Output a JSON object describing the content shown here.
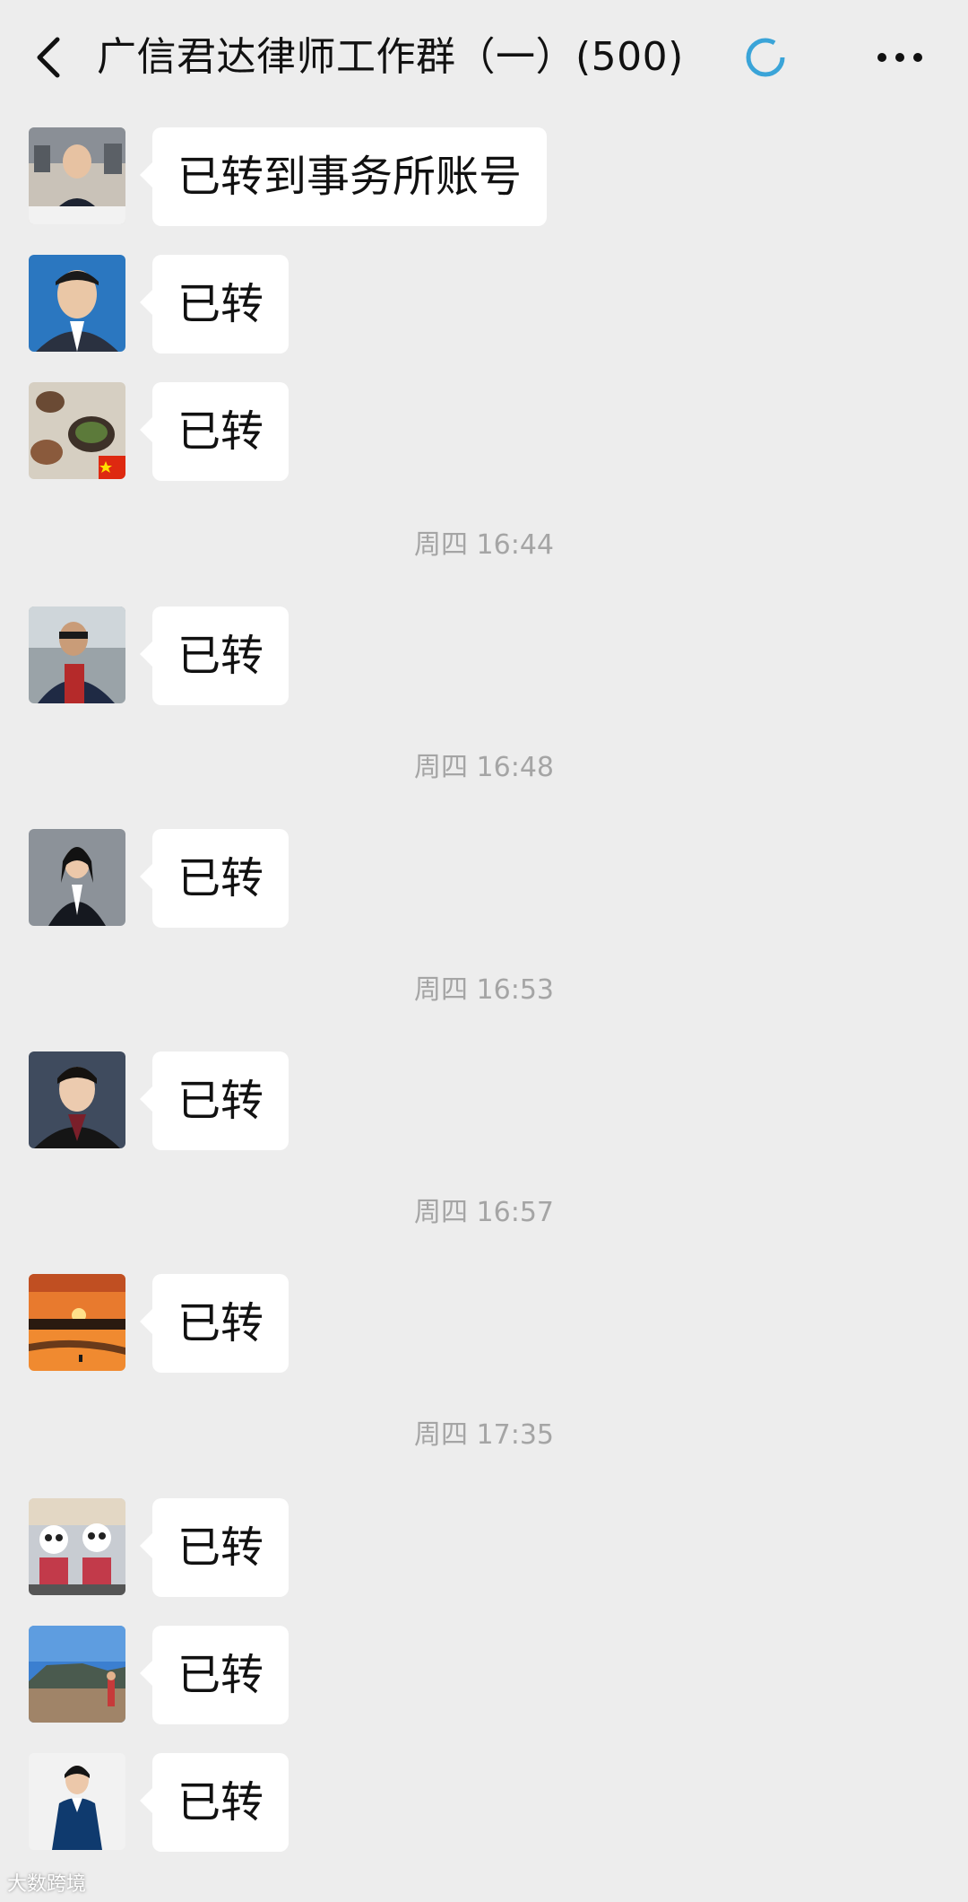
{
  "header": {
    "title": "广信君达律师工作群（一）(500)",
    "back_icon": "chevron-left-icon",
    "loading_icon": "loading-spinner-icon",
    "more_icon": "more-dots-icon"
  },
  "messages": [
    {
      "text": "已转到事务所账号",
      "avatar": "avatar-1"
    },
    {
      "text": "已转",
      "avatar": "avatar-2"
    },
    {
      "text": "已转",
      "avatar": "avatar-3"
    },
    {
      "text": "已转",
      "avatar": "avatar-4"
    },
    {
      "text": "已转",
      "avatar": "avatar-5"
    },
    {
      "text": "已转",
      "avatar": "avatar-6"
    },
    {
      "text": "已转",
      "avatar": "avatar-7"
    },
    {
      "text": "已转",
      "avatar": "avatar-8"
    },
    {
      "text": "已转",
      "avatar": "avatar-9"
    },
    {
      "text": "已转",
      "avatar": "avatar-10"
    }
  ],
  "timestamps": [
    "周四 16:44",
    "周四 16:48",
    "周四 16:53",
    "周四 16:57",
    "周四 17:35"
  ],
  "watermark": "大数跨境",
  "colors": {
    "background": "#ededed",
    "bubble": "#ffffff",
    "timestamp": "#a5a5a5",
    "spinner": "#3aa4d8"
  }
}
